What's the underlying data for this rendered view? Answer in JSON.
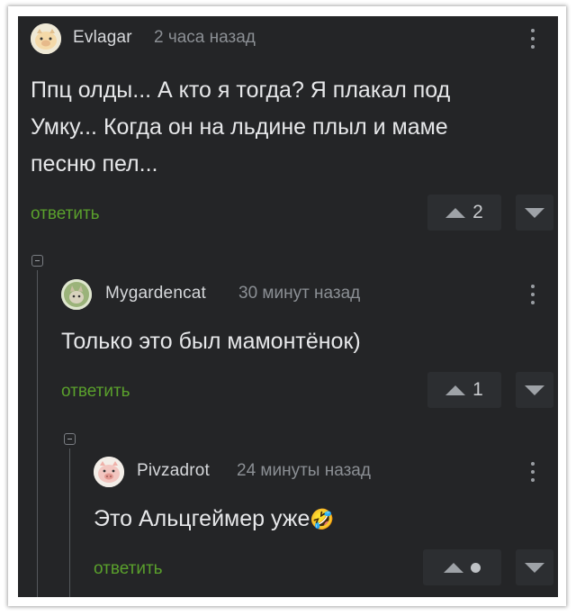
{
  "comments": [
    {
      "username": "Evlagar",
      "time": "2 часа назад",
      "text_line1": "Ппц олды... А кто я тогда? Я плакал под",
      "text_line2": "Умку... Когда он на льдине плыл и маме",
      "text_line3": "песню пел...",
      "reply_label": "ответить",
      "rating": "2",
      "avatar_icon": "piggy-avatar-icon"
    },
    {
      "username": "Mygardencat",
      "time": "30 минут назад",
      "text_line1": "Только это был мамонтёнок)",
      "reply_label": "ответить",
      "rating": "1",
      "avatar_icon": "cat-avatar-icon"
    },
    {
      "username": "Pivzadrot",
      "time": "24 минуты назад",
      "text_line1": "Это Альцгеймер уже",
      "emoji": "🤣",
      "reply_label": "ответить",
      "rating": "•",
      "avatar_icon": "pig-avatar-icon"
    }
  ],
  "colors": {
    "background": "#242527",
    "reply_link": "#5aa02c",
    "text": "#e6e7e9",
    "meta": "#8b8f94"
  }
}
